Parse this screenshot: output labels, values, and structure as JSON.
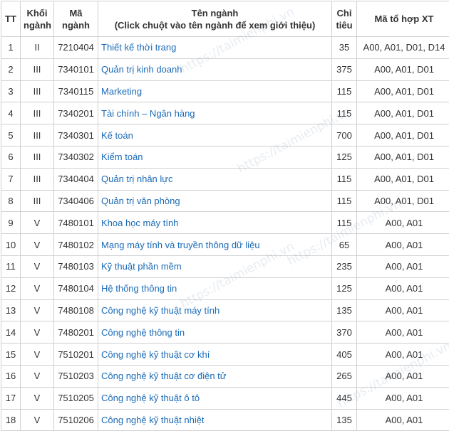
{
  "headers": {
    "tt": "TT",
    "khoi_line1": "Khối",
    "khoi_line2": "ngành",
    "ma_line1": "Mã",
    "ma_line2": "ngành",
    "ten_line1": "Tên ngành",
    "ten_line2": "(Click chuột vào tên ngành để xem giới thiệu)",
    "chitieu_line1": "Chỉ",
    "chitieu_line2": "tiêu",
    "xt": "Mã tổ hợp XT"
  },
  "rows": [
    {
      "tt": "1",
      "khoi": "II",
      "ma": "7210404",
      "ten": "Thiết kế thời trang",
      "chitieu": "35",
      "xt": "A00, A01, D01, D14"
    },
    {
      "tt": "2",
      "khoi": "III",
      "ma": "7340101",
      "ten": "Quản trị kinh doanh",
      "chitieu": "375",
      "xt": "A00, A01, D01"
    },
    {
      "tt": "3",
      "khoi": "III",
      "ma": "7340115",
      "ten": "Marketing",
      "chitieu": "115",
      "xt": "A00, A01, D01"
    },
    {
      "tt": "4",
      "khoi": "III",
      "ma": "7340201",
      "ten": "Tài chính – Ngân hàng",
      "chitieu": "115",
      "xt": "A00, A01, D01"
    },
    {
      "tt": "5",
      "khoi": "III",
      "ma": "7340301",
      "ten": "Kế toán",
      "chitieu": "700",
      "xt": "A00, A01, D01"
    },
    {
      "tt": "6",
      "khoi": "III",
      "ma": "7340302",
      "ten": "Kiểm toán",
      "chitieu": "125",
      "xt": "A00, A01, D01"
    },
    {
      "tt": "7",
      "khoi": "III",
      "ma": "7340404",
      "ten": "Quản trị nhân lực",
      "chitieu": "115",
      "xt": "A00, A01, D01"
    },
    {
      "tt": "8",
      "khoi": "III",
      "ma": "7340406",
      "ten": "Quản trị văn phòng",
      "chitieu": "115",
      "xt": "A00, A01, D01"
    },
    {
      "tt": "9",
      "khoi": "V",
      "ma": "7480101",
      "ten": "Khoa học máy tính",
      "chitieu": "115",
      "xt": "A00, A01"
    },
    {
      "tt": "10",
      "khoi": "V",
      "ma": "7480102",
      "ten": "Mạng máy tính và truyền thông dữ liệu",
      "chitieu": "65",
      "xt": "A00, A01"
    },
    {
      "tt": "11",
      "khoi": "V",
      "ma": "7480103",
      "ten": "Kỹ thuật phần mềm",
      "chitieu": "235",
      "xt": "A00, A01"
    },
    {
      "tt": "12",
      "khoi": "V",
      "ma": "7480104",
      "ten": "Hệ thống thông tin",
      "chitieu": "125",
      "xt": "A00, A01"
    },
    {
      "tt": "13",
      "khoi": "V",
      "ma": "7480108",
      "ten": "Công nghệ kỹ thuật máy tính",
      "chitieu": "135",
      "xt": "A00, A01"
    },
    {
      "tt": "14",
      "khoi": "V",
      "ma": "7480201",
      "ten": "Công nghệ thông tin",
      "chitieu": "370",
      "xt": "A00, A01"
    },
    {
      "tt": "15",
      "khoi": "V",
      "ma": "7510201",
      "ten": "Công nghệ kỹ thuật cơ khí",
      "chitieu": "405",
      "xt": "A00, A01"
    },
    {
      "tt": "16",
      "khoi": "V",
      "ma": "7510203",
      "ten": "Công nghệ kỹ thuật cơ điện tử",
      "chitieu": "265",
      "xt": "A00, A01"
    },
    {
      "tt": "17",
      "khoi": "V",
      "ma": "7510205",
      "ten": "Công nghệ kỹ thuật ô tô",
      "chitieu": "445",
      "xt": "A00, A01"
    },
    {
      "tt": "18",
      "khoi": "V",
      "ma": "7510206",
      "ten": "Công nghệ kỹ thuật nhiệt",
      "chitieu": "135",
      "xt": "A00, A01"
    }
  ],
  "watermark": "https://taimienphi.vn",
  "colors": {
    "link": "#1a6ab7",
    "border": "#d0d0d0",
    "text": "#333333"
  }
}
